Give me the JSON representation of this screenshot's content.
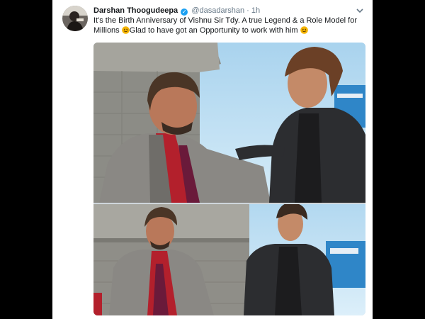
{
  "tweet": {
    "author_name": "Darshan Thoogudeepa",
    "handle": "@dasadarshan",
    "separator": "·",
    "time": "1h",
    "text_part1": "It's the Birth Anniversary of Vishnu Sir Tdy. A true Legend & a Role Model for Millions",
    "text_part2": "Glad to have got an Opportunity to work with him",
    "verified": true
  },
  "icons": {
    "verified": "verified-badge-icon",
    "menu": "chevron-down-icon",
    "emoji": "smiling-face-emoji"
  },
  "colors": {
    "accent": "#1da1f2",
    "text": "#14171a",
    "secondary_text": "#657786",
    "emoji": "#f5b400"
  },
  "media": {
    "photos": [
      "photo-top",
      "photo-bottom"
    ]
  }
}
